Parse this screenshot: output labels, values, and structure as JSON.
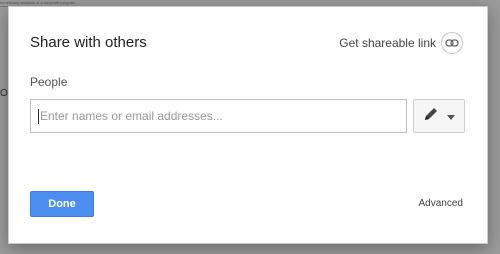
{
  "background": {
    "top_text": "beneficiary analysis of a nonprofit program...",
    "side_word": "OU"
  },
  "dialog": {
    "title": "Share with others",
    "shareable_link_label": "Get shareable link",
    "people_label": "People",
    "input": {
      "placeholder": "Enter names or email addresses...",
      "value": ""
    },
    "permission_icon": "pencil-icon",
    "done_label": "Done",
    "advanced_label": "Advanced"
  },
  "colors": {
    "accent": "#4d8ff0",
    "text": "#222222",
    "muted": "#9a9a9a"
  }
}
